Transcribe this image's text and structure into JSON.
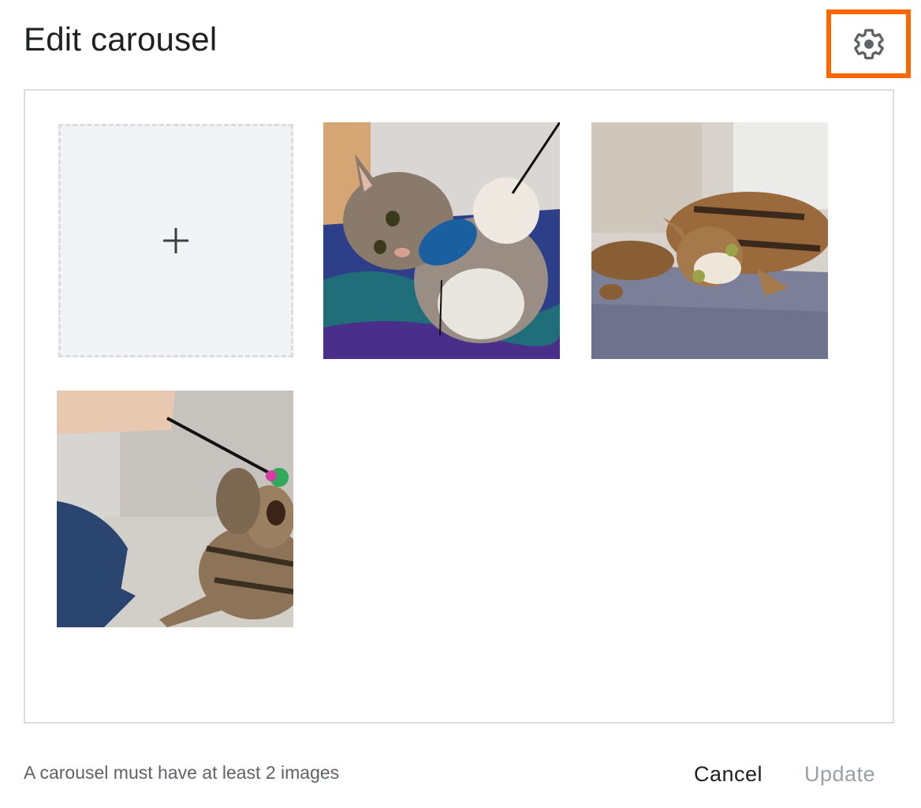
{
  "dialog": {
    "title": "Edit carousel",
    "settings_icon": "gear-icon",
    "accent_color": "#ff6600"
  },
  "gallery": {
    "add_tile_icon": "plus-icon",
    "images": [
      {
        "subject": "kitten playing with feather toy"
      },
      {
        "subject": "tabby cat lying on floor"
      },
      {
        "subject": "person playing with cat using wand toy"
      }
    ]
  },
  "footer": {
    "hint": "A carousel must have at least 2 images",
    "cancel_label": "Cancel",
    "update_label": "Update",
    "update_disabled": true
  }
}
